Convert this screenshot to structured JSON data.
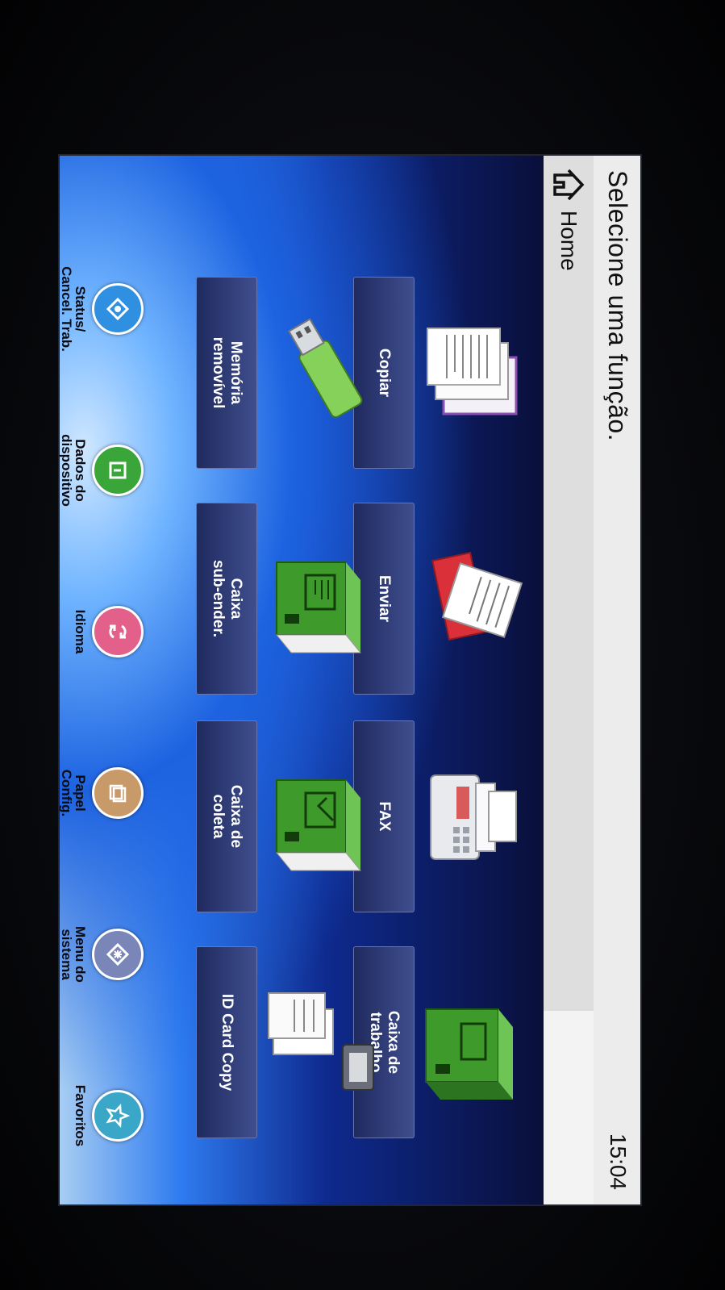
{
  "header": {
    "title": "Selecione uma função.",
    "clock": "15:04"
  },
  "tab": {
    "label": "Home"
  },
  "functions": [
    {
      "label": "Copiar",
      "icon": "copy-icon"
    },
    {
      "label": "Enviar",
      "icon": "send-icon"
    },
    {
      "label": "FAX",
      "icon": "fax-icon"
    },
    {
      "label": "Caixa de\ntrabalho",
      "icon": "job-box-icon"
    },
    {
      "label": "Memória\nremovível",
      "icon": "usb-drive-icon"
    },
    {
      "label": "Caixa\nsub-ender.",
      "icon": "subaddress-box-icon"
    },
    {
      "label": "Caixa de\ncoleta",
      "icon": "polling-box-icon"
    },
    {
      "label": "ID Card Copy",
      "icon": "id-card-copy-icon"
    }
  ],
  "bottom": [
    {
      "label": "Status/\nCancel. Trab.",
      "icon": "status-icon",
      "color": "#2f8fe0"
    },
    {
      "label": "Dados do\ndispositivo",
      "icon": "device-info-icon",
      "color": "#3aa63a"
    },
    {
      "label": "Idioma",
      "icon": "language-icon",
      "color": "#e2608a"
    },
    {
      "label": "Papel\nConfig.",
      "icon": "paper-settings-icon",
      "color": "#c89a6a"
    },
    {
      "label": "Menu do\nsistema",
      "icon": "system-menu-icon",
      "color": "#7b86b8"
    },
    {
      "label": "Favoritos",
      "icon": "favorites-icon",
      "color": "#3ba7c8"
    }
  ]
}
